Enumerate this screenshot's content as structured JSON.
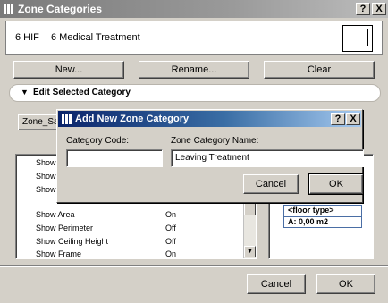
{
  "window": {
    "title": "Zone Categories",
    "help_label": "?",
    "close_label": "X"
  },
  "category": {
    "code": "6 HIF",
    "name": "6 Medical Treatment"
  },
  "buttons": {
    "new": "New...",
    "rename": "Rename...",
    "clear": "Clear",
    "cancel": "Cancel",
    "ok": "OK"
  },
  "edit_section": {
    "label": "Edit Selected Category",
    "tab_label": "Zone_Sa"
  },
  "settings_rows": [
    {
      "label": "Show",
      "value": ""
    },
    {
      "label": "Show",
      "value": ""
    },
    {
      "label": "Show",
      "value": ""
    },
    {
      "label": "Show Area",
      "value": "On"
    },
    {
      "label": "Show Perimeter",
      "value": "Off"
    },
    {
      "label": "Show Ceiling Height",
      "value": "Off"
    },
    {
      "label": "Show Frame",
      "value": "On"
    }
  ],
  "preview": {
    "floor_type": "<floor type>",
    "area": "A: 0,00 m2"
  },
  "dialog": {
    "title": "Add New Zone Category",
    "help_label": "?",
    "close_label": "X",
    "code_label": "Category Code:",
    "code_value": "",
    "name_label": "Zone Category Name:",
    "name_value": "Leaving Treatment",
    "cancel": "Cancel",
    "ok": "OK"
  }
}
